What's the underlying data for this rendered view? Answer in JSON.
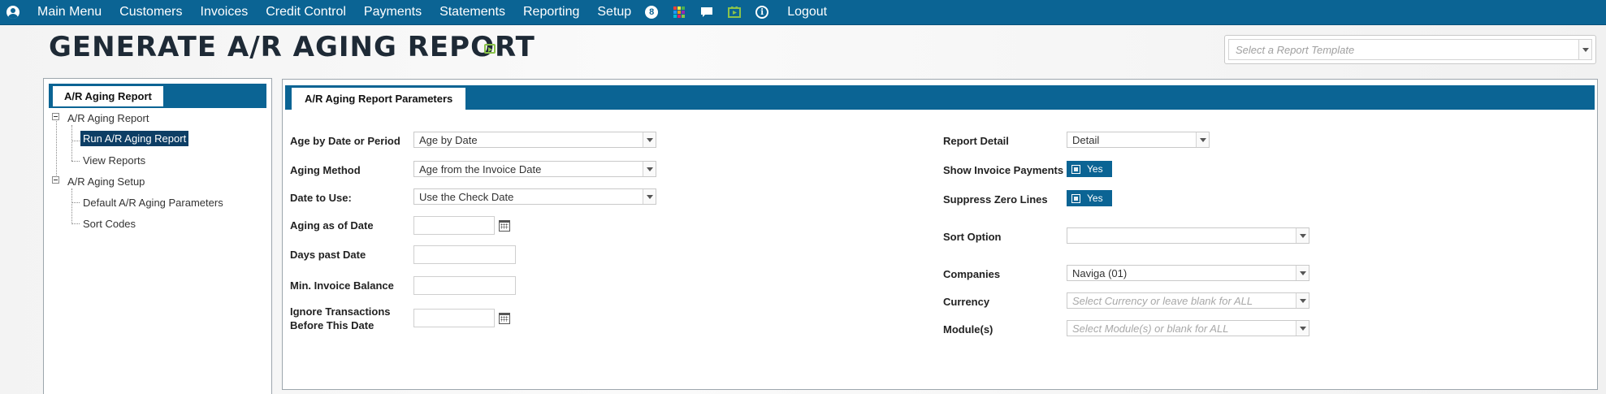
{
  "nav": {
    "items": [
      "Main Menu",
      "Customers",
      "Invoices",
      "Credit Control",
      "Payments",
      "Statements",
      "Reporting",
      "Setup"
    ],
    "badge": "8",
    "logout": "Logout"
  },
  "page": {
    "title": "GENERATE A/R AGING REPORT",
    "template_placeholder": "Select a Report Template"
  },
  "sidebar": {
    "tab": "A/R Aging Report",
    "tree": [
      {
        "label": "A/R Aging Report"
      },
      {
        "label": "Run A/R Aging Report",
        "selected": true
      },
      {
        "label": "View Reports"
      },
      {
        "label": "A/R Aging Setup"
      },
      {
        "label": "Default A/R Aging Parameters"
      },
      {
        "label": "Sort Codes"
      }
    ]
  },
  "params": {
    "tab": "A/R Aging Report Parameters",
    "age_by": {
      "label": "Age by Date or Period",
      "value": "Age by Date"
    },
    "aging_method": {
      "label": "Aging Method",
      "value": "Age from the Invoice Date"
    },
    "date_to_use": {
      "label": "Date to Use:",
      "value": "Use the Check Date"
    },
    "aging_as_of": {
      "label": "Aging as of Date",
      "value": ""
    },
    "days_past": {
      "label": "Days past Date",
      "value": ""
    },
    "min_balance": {
      "label": "Min. Invoice Balance",
      "value": ""
    },
    "ignore_before": {
      "label_line1": "Ignore Transactions",
      "label_line2": "Before This Date",
      "value": ""
    },
    "report_detail": {
      "label": "Report Detail",
      "value": "Detail"
    },
    "show_payments": {
      "label": "Show Invoice Payments",
      "value": "Yes"
    },
    "suppress_zero": {
      "label": "Suppress Zero Lines",
      "value": "Yes"
    },
    "sort_option": {
      "label": "Sort Option",
      "value": ""
    },
    "companies": {
      "label": "Companies",
      "value": "Naviga (01)"
    },
    "currency": {
      "label": "Currency",
      "placeholder": "Select Currency or leave blank for ALL"
    },
    "modules": {
      "label": "Module(s)",
      "placeholder": "Select Module(s) or blank for ALL"
    }
  },
  "colors": {
    "brand": "#0b6494",
    "selected": "#0d3e65",
    "accent_green": "#8bc34a"
  }
}
